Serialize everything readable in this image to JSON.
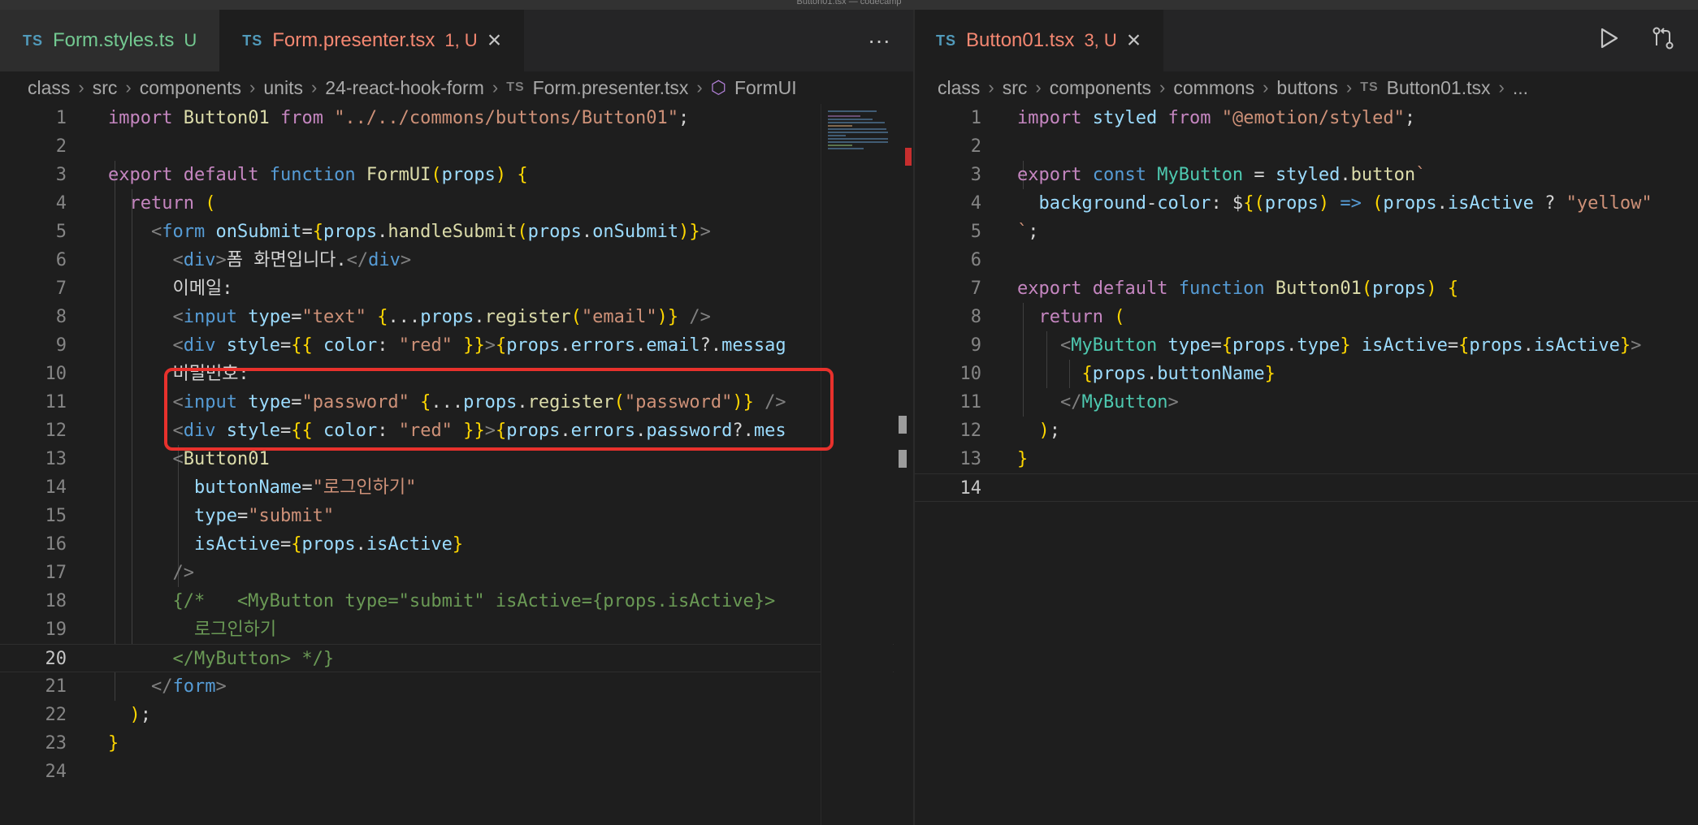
{
  "window_title": "Button01.tsx — codecamp",
  "left": {
    "tabs": [
      {
        "icon": "TS",
        "name": "Form.styles.ts",
        "status": "U",
        "color": "green",
        "active": false
      },
      {
        "icon": "TS",
        "name": "Form.presenter.tsx",
        "status": "1, U",
        "color": "red",
        "active": true
      }
    ],
    "more_label": "···",
    "breadcrumb": [
      "class",
      "src",
      "components",
      "units",
      "24-react-hook-form",
      "Form.presenter.tsx",
      "FormUI"
    ],
    "lines": [
      "import Button01 from \"../../commons/buttons/Button01\";",
      "",
      "export default function FormUI(props) {",
      "  return (",
      "    <form onSubmit={props.handleSubmit(props.onSubmit)}>",
      "      <div>폼 화면입니다.</div>",
      "      이메일:",
      "      <input type=\"text\" {...props.register(\"email\")} />",
      "      <div style={{ color: \"red\" }}>{props.errors.email?.messag",
      "      비밀번호:",
      "      <input type=\"password\" {...props.register(\"password\")} />",
      "      <div style={{ color: \"red\" }}>{props.errors.password?.mes",
      "      <Button01",
      "        buttonName=\"로그인하기\"",
      "        type=\"submit\"",
      "        isActive={props.isActive}",
      "      />",
      "      {/*   <MyButton type=\"submit\" isActive={props.isActive}>",
      "        로그인하기",
      "      </MyButton> */}",
      "    </form>",
      "  );",
      "}",
      ""
    ]
  },
  "right": {
    "tabs": [
      {
        "icon": "TS",
        "name": "Button01.tsx",
        "status": "3, U",
        "color": "red",
        "active": true
      }
    ],
    "breadcrumb": [
      "class",
      "src",
      "components",
      "commons",
      "buttons",
      "Button01.tsx",
      "..."
    ],
    "lines": [
      "import styled from \"@emotion/styled\";",
      "",
      "export const MyButton = styled.button`",
      "  background-color: ${(props) => (props.isActive ? \"yellow\"",
      "`;",
      "",
      "export default function Button01(props) {",
      "  return (",
      "    <MyButton type={props.type} isActive={props.isActive}>",
      "      {props.buttonName}",
      "    </MyButton>",
      "  );",
      "}",
      ""
    ]
  },
  "colors": {
    "background": "#1e1e1e",
    "tabbar": "#252526",
    "highlight_box": "#e8312c",
    "error_red": "#f48771",
    "untracked_green": "#73c991"
  },
  "icons": [
    "ts-file-icon",
    "close-icon",
    "more-actions-icon",
    "run-icon",
    "source-control-compare-icon",
    "chevron-right-icon",
    "symbol-method-icon"
  ]
}
